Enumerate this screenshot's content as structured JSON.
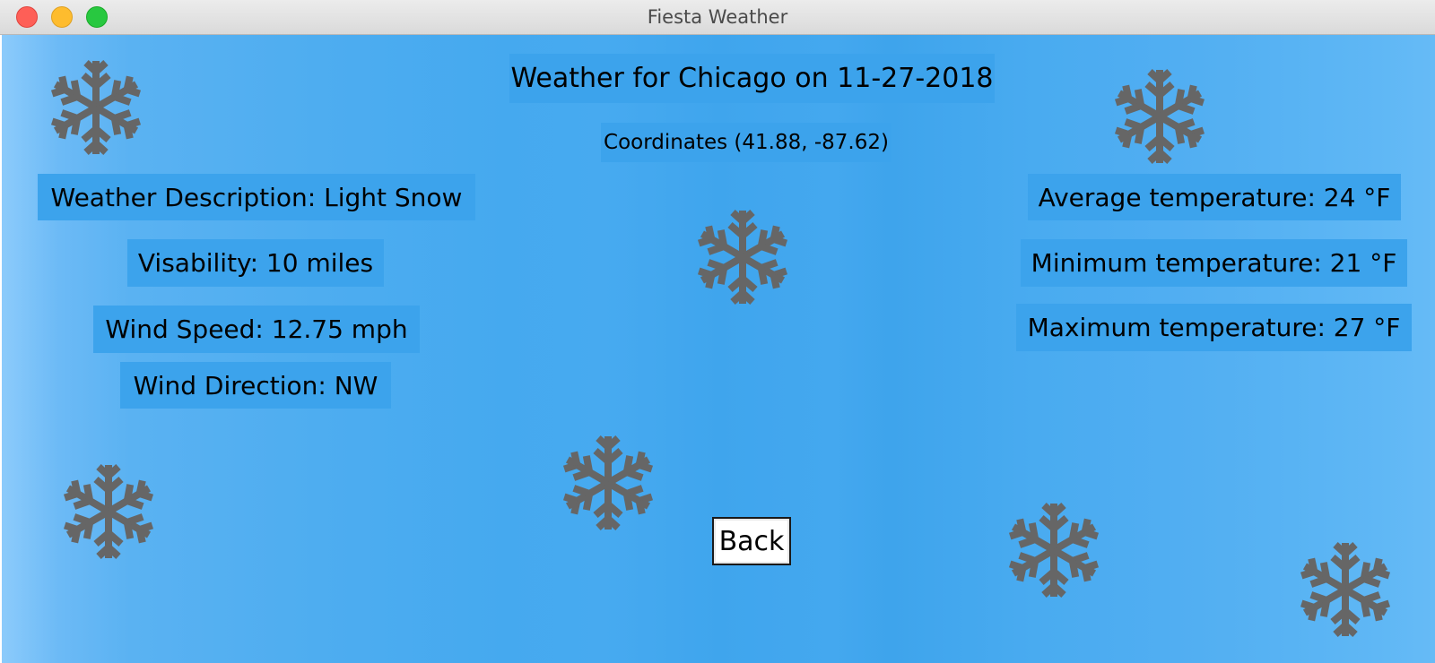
{
  "window": {
    "title": "Fiesta Weather"
  },
  "header": {
    "title": "Weather for Chicago on 11-27-2018",
    "coordinates": "Coordinates (41.88, -87.62)"
  },
  "left_panel": {
    "description": "Weather Description: Light Snow",
    "visibility": "Visability: 10 miles",
    "wind_speed": "Wind Speed: 12.75 mph",
    "wind_direction": "Wind Direction: NW"
  },
  "right_panel": {
    "avg_temp": "Average temperature: 24 °F",
    "min_temp": "Minimum temperature: 21 °F",
    "max_temp": "Maximum temperature: 27 °F"
  },
  "actions": {
    "back_label": "Back"
  },
  "icons": {
    "weather_icon": "snowflake-icon"
  },
  "colors": {
    "label_bg": "#3ca3ec",
    "snowflake": "#666666",
    "background_light": "#8ccbfb",
    "background_dark": "#3fa5ed"
  }
}
